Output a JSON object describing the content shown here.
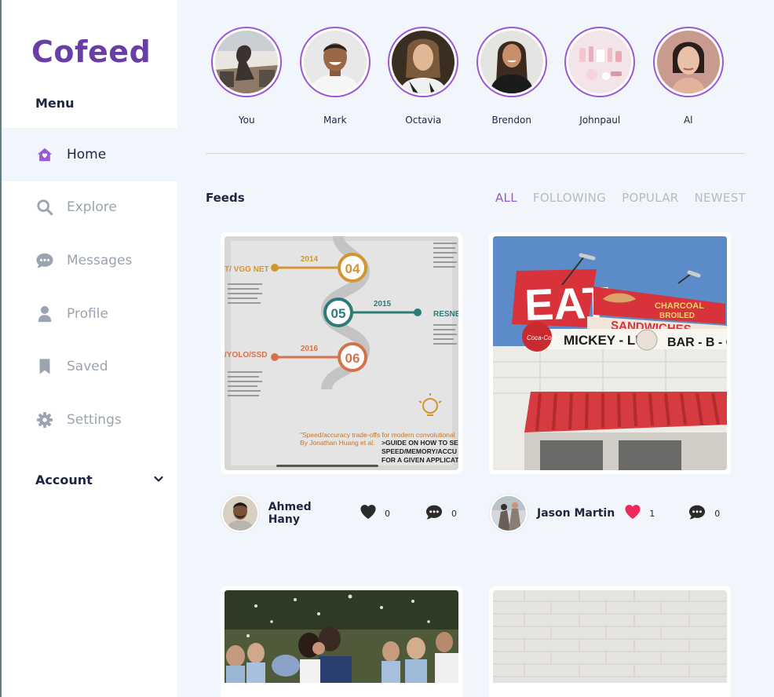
{
  "brand": "Cofeed",
  "sidebar": {
    "menu_title": "Menu",
    "items": [
      {
        "label": "Home",
        "icon": "home-icon"
      },
      {
        "label": "Explore",
        "icon": "search-icon"
      },
      {
        "label": "Messages",
        "icon": "chat-icon"
      },
      {
        "label": "Profile",
        "icon": "user-icon"
      },
      {
        "label": "Saved",
        "icon": "bookmark-icon"
      },
      {
        "label": "Settings",
        "icon": "gear-icon"
      }
    ],
    "account_label": "Account"
  },
  "stories": [
    {
      "name": "You"
    },
    {
      "name": "Mark"
    },
    {
      "name": "Octavia"
    },
    {
      "name": "Brendon"
    },
    {
      "name": "Johnpaul"
    },
    {
      "name": "Al"
    }
  ],
  "feeds": {
    "title": "Feeds",
    "filters": [
      "ALL",
      "FOLLOWING",
      "POPULAR",
      "NEWEST"
    ],
    "active_filter": "ALL"
  },
  "posts": [
    {
      "author": "Ahmed Hany",
      "likes": "0",
      "comments": "0",
      "liked": false,
      "image_text": {
        "year1": "2014",
        "num1": "04",
        "year2": "2015",
        "num2": "05",
        "year3": "2016",
        "num3": "06",
        "label_left1": "T/ VGG NET",
        "label_left2": "/YOLO/SSD",
        "label_right": "RESNET",
        "caption1": "\"Speed/accuracy trade-offs for modern convolutional",
        "caption2": "By Jonathan Huang et al.",
        "guide1": ">GUIDE ON HOW TO SEL",
        "guide2": "SPEED/MEMORY/ACCU",
        "guide3": "FOR A GIVEN APPLICAT"
      }
    },
    {
      "author": "Jason Martin",
      "likes": "1",
      "comments": "0",
      "liked": true,
      "image_text": {
        "eat": "EAT",
        "charcoal1": "CHARCOAL",
        "charcoal2": "BROILED",
        "sandwiches": "SANDWICHES",
        "mickey": "MICKEY - LU",
        "barbq": "BAR - B - Q"
      }
    },
    {
      "author": "",
      "likes": "",
      "comments": ""
    },
    {
      "author": "",
      "likes": "",
      "comments": ""
    }
  ],
  "colors": {
    "accent": "#9b59d6",
    "brand": "#6a3fa5",
    "like_active": "#f0295a",
    "text_dark": "#1e2540",
    "text_muted": "#9aa3b0"
  }
}
